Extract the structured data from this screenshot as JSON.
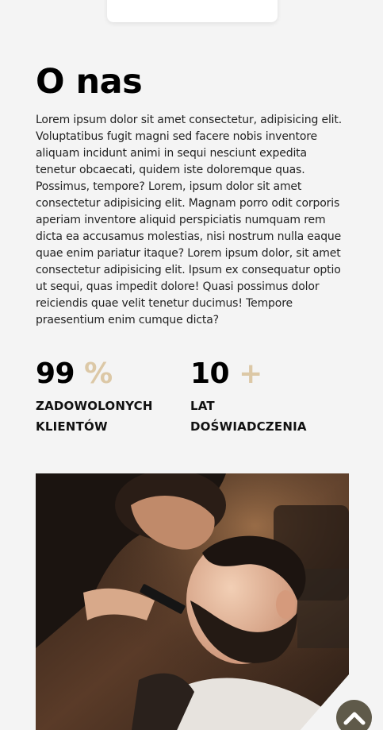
{
  "about": {
    "title": "O nas",
    "paragraph": "Lorem ipsum dolor sit amet consectetur, adipisicing elit. Voluptatibus fugit magni sed facere nobis inventore aliquam incidunt animi in sequi nesciunt expedita tenetur obcaecati, quidem iste doloremque quas. Possimus, tempore? Lorem, ipsum dolor sit amet consectetur adipisicing elit. Magnam porro odit corporis aperiam inventore aliquid perspiciatis numquam rem dicta ea accusamus molestias, nisi nostrum nulla eaque quae enim pariatur itaque? Lorem ipsum dolor, sit amet consectetur adipisicing elit. Ipsum ex consequatur optio ut sequi, quas impedit dolore! Quasi possimus dolor reiciendis quae velit tenetur ducimus! Tempore praesentium enim cumque dicta?"
  },
  "stats": [
    {
      "number": "99",
      "suffix": "%",
      "label_line1": "ZADOWOLONYCH",
      "label_line2": "KLIENTÓW"
    },
    {
      "number": "10",
      "suffix": "+",
      "label_line1": "LAT",
      "label_line2": "DOŚWIADCZENIA"
    }
  ],
  "colors": {
    "accent": "#dcc8a6",
    "background": "#f4f4f4",
    "scroll_button": "#5f5a4a"
  },
  "icons": {
    "scroll_top": "chevron-up-icon"
  }
}
